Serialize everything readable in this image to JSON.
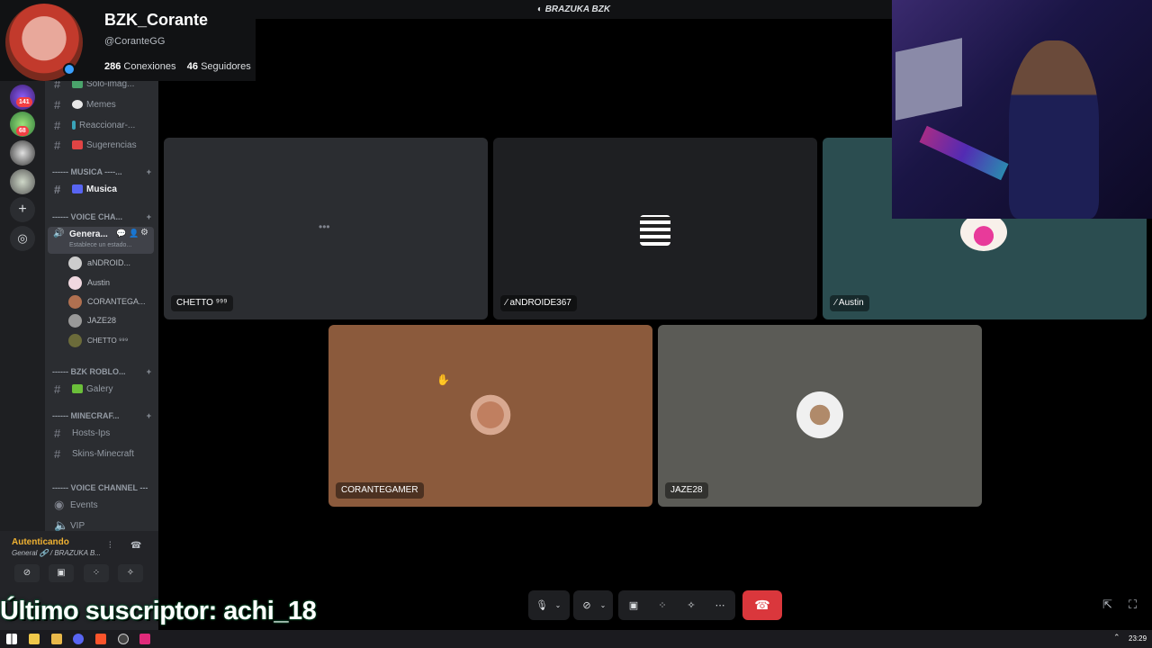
{
  "profile": {
    "name": "BZK_Corante",
    "handle": "@CoranteGG",
    "connections_count": "286",
    "connections_label": "Conexiones",
    "followers_count": "46",
    "followers_label": "Seguidores"
  },
  "server": {
    "title": "BRAZUKA BZK"
  },
  "rail": {
    "badges": [
      "141",
      "68"
    ]
  },
  "channels": {
    "text_top": [
      {
        "label": "Solo-imag..."
      },
      {
        "label": "Memes"
      },
      {
        "label": "Reaccionar-..."
      },
      {
        "label": "Sugerencias"
      }
    ],
    "cat_music": "------ MUSICA ----...",
    "music": "Musica",
    "cat_voice": "------ VOICE CHA...",
    "voice_active": {
      "label": "Genera...",
      "status": "Establece un estado..."
    },
    "voice_users": [
      {
        "name": "aNDROID..."
      },
      {
        "name": "Austin"
      },
      {
        "name": "CORANTEGA..."
      },
      {
        "name": "JAZE28"
      },
      {
        "name": "CHETTO ⁹⁹⁹"
      }
    ],
    "cat_roblox": "------ BZK ROBLO...",
    "galery": "Galery",
    "cat_mine": "------ MINECRAF...",
    "mine": [
      {
        "label": "Hosts-Ips"
      },
      {
        "label": "Skins-Minecraft"
      }
    ],
    "cat_voice2": "------ VOICE CHANNEL ---",
    "events": "Events",
    "vip": "VIP"
  },
  "user_panel": {
    "status": "Autenticando",
    "sub": "General 🔗 / BRAZUKA B..."
  },
  "tiles": [
    {
      "label": "CHETTO ⁹⁹⁹",
      "color": "#2b2d31"
    },
    {
      "label": "aNDROIDE367",
      "color": "#1e1f22"
    },
    {
      "label": "Austin",
      "color": "#2b4d50"
    },
    {
      "label": "CORANTEGAMER",
      "color": "#8b5a3c"
    },
    {
      "label": "JAZE28",
      "color": "#5b5b56"
    }
  ],
  "overlay": {
    "subscriber": "Último suscriptor: achi_18"
  },
  "taskbar": {
    "time": "23:29"
  }
}
